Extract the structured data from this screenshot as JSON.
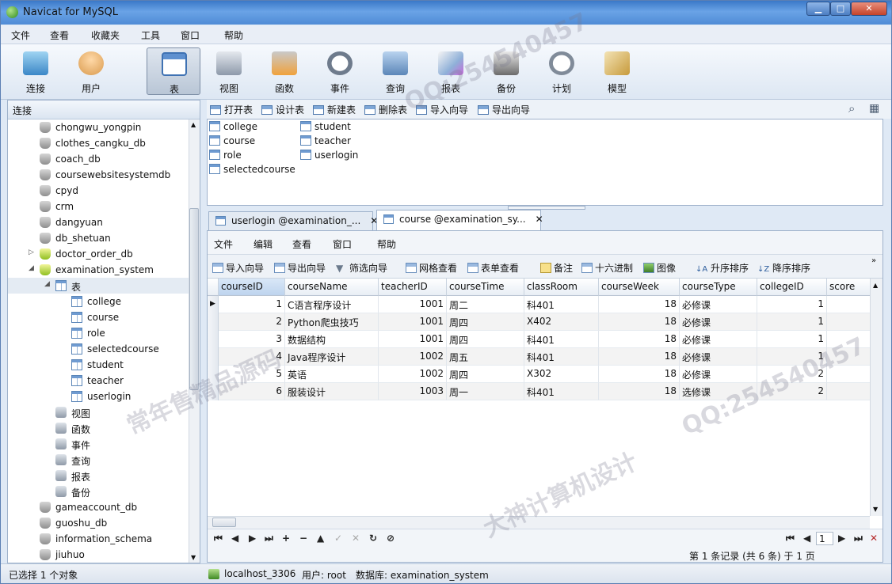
{
  "window": {
    "title": "Navicat for MySQL",
    "controls": [
      "▁",
      "□",
      "✕"
    ]
  },
  "menu": [
    "文件",
    "查看",
    "收藏夹",
    "工具",
    "窗口",
    "帮助"
  ],
  "toolbar": [
    {
      "label": "连接",
      "icon": "connection-icon"
    },
    {
      "label": "用户",
      "icon": "user-icon"
    },
    {
      "label": "表",
      "icon": "table-icon",
      "selected": true
    },
    {
      "label": "视图",
      "icon": "view-icon"
    },
    {
      "label": "函数",
      "icon": "function-icon"
    },
    {
      "label": "事件",
      "icon": "event-icon"
    },
    {
      "label": "查询",
      "icon": "query-icon"
    },
    {
      "label": "报表",
      "icon": "report-icon"
    },
    {
      "label": "备份",
      "icon": "backup-icon"
    },
    {
      "label": "计划",
      "icon": "schedule-icon"
    },
    {
      "label": "模型",
      "icon": "model-icon"
    }
  ],
  "left_panel": {
    "header": "连接",
    "tree": [
      {
        "label": "chongwu_yongpin",
        "level": 1,
        "type": "db"
      },
      {
        "label": "clothes_cangku_db",
        "level": 1,
        "type": "db"
      },
      {
        "label": "coach_db",
        "level": 1,
        "type": "db"
      },
      {
        "label": "coursewebsitesystemdb",
        "level": 1,
        "type": "db"
      },
      {
        "label": "cpyd",
        "level": 1,
        "type": "db"
      },
      {
        "label": "crm",
        "level": 1,
        "type": "db"
      },
      {
        "label": "dangyuan",
        "level": 1,
        "type": "db"
      },
      {
        "label": "db_shetuan",
        "level": 1,
        "type": "db"
      },
      {
        "label": "doctor_order_db",
        "level": 1,
        "type": "db-open",
        "arrow": "▷"
      },
      {
        "label": "examination_system",
        "level": 1,
        "type": "db-open",
        "arrow": "◢"
      },
      {
        "label": "表",
        "level": 2,
        "type": "folder",
        "arrow": "◢",
        "selected": true
      },
      {
        "label": "college",
        "level": 3,
        "type": "table"
      },
      {
        "label": "course",
        "level": 3,
        "type": "table"
      },
      {
        "label": "role",
        "level": 3,
        "type": "table"
      },
      {
        "label": "selectedcourse",
        "level": 3,
        "type": "table"
      },
      {
        "label": "student",
        "level": 3,
        "type": "table"
      },
      {
        "label": "teacher",
        "level": 3,
        "type": "table"
      },
      {
        "label": "userlogin",
        "level": 3,
        "type": "table"
      },
      {
        "label": "视图",
        "level": 2,
        "type": "view"
      },
      {
        "label": "函数",
        "level": 2,
        "type": "func"
      },
      {
        "label": "事件",
        "level": 2,
        "type": "event"
      },
      {
        "label": "查询",
        "level": 2,
        "type": "query"
      },
      {
        "label": "报表",
        "level": 2,
        "type": "report"
      },
      {
        "label": "备份",
        "level": 2,
        "type": "backup"
      },
      {
        "label": "gameaccount_db",
        "level": 1,
        "type": "db"
      },
      {
        "label": "guoshu_db",
        "level": 1,
        "type": "db"
      },
      {
        "label": "information_schema",
        "level": 1,
        "type": "db"
      },
      {
        "label": "jiuhuo",
        "level": 1,
        "type": "db"
      }
    ]
  },
  "object_toolbar": [
    "打开表",
    "设计表",
    "新建表",
    "删除表",
    "导入向导",
    "导出向导"
  ],
  "objects": {
    "col1": [
      "college",
      "course",
      "role",
      "selectedcourse"
    ],
    "col2": [
      "student",
      "teacher",
      "userlogin"
    ]
  },
  "tabs": [
    {
      "label": "userlogin @examination_...",
      "active": false
    },
    {
      "label": "course @examination_sy...",
      "active": true
    }
  ],
  "grid_menu": [
    "文件",
    "编辑",
    "查看",
    "窗口",
    "帮助"
  ],
  "grid_toolbar": [
    "导入向导",
    "导出向导",
    "筛选向导",
    "网格查看",
    "表单查看",
    "备注",
    "十六进制",
    "图像",
    "升序排序",
    "降序排序"
  ],
  "table": {
    "columns": [
      "courseID",
      "courseName",
      "teacherID",
      "courseTime",
      "classRoom",
      "courseWeek",
      "courseType",
      "collegeID",
      "score"
    ],
    "rows": [
      [
        "1",
        "C语言程序设计",
        "1001",
        "周二",
        "科401",
        "18",
        "必修课",
        "1",
        ""
      ],
      [
        "2",
        "Python爬虫技巧",
        "1001",
        "周四",
        "X402",
        "18",
        "必修课",
        "1",
        ""
      ],
      [
        "3",
        "数据结构",
        "1001",
        "周四",
        "科401",
        "18",
        "必修课",
        "1",
        ""
      ],
      [
        "4",
        "Java程序设计",
        "1002",
        "周五",
        "科401",
        "18",
        "必修课",
        "1",
        ""
      ],
      [
        "5",
        "英语",
        "1002",
        "周四",
        "X302",
        "18",
        "必修课",
        "2",
        ""
      ],
      [
        "6",
        "服装设计",
        "1003",
        "周一",
        "科401",
        "18",
        "选修课",
        "2",
        ""
      ]
    ]
  },
  "grid_nav": {
    "buttons": [
      "⏮",
      "◀",
      "▶",
      "⏭",
      "+",
      "−",
      "▲",
      "✓",
      "✕",
      "↻",
      "⊘"
    ],
    "page": "1",
    "record_info": "第 1 条记录 (共 6 条) 于 1 页"
  },
  "status": {
    "selection": "已选择 1 个对象",
    "host": "localhost_3306",
    "user": "用户: root",
    "database": "数据库: examination_system"
  },
  "watermarks": [
    "QQ:254540457",
    "常年售精品源码",
    "大神计算机设计"
  ]
}
